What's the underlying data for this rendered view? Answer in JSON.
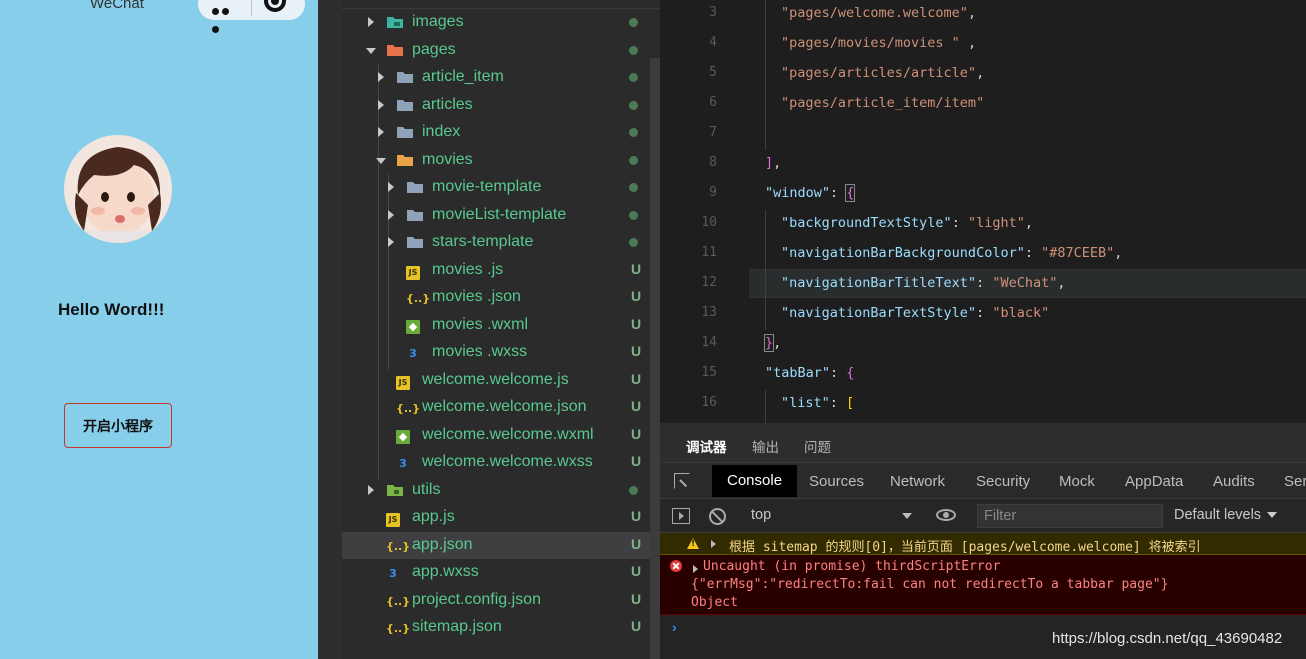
{
  "simulator": {
    "nav_title": "WeChat",
    "hello_text": "Hello Word!!!",
    "open_button": "开启小程序",
    "background_color": "#87CEEB"
  },
  "file_tree": [
    {
      "label": "images",
      "type": "folder-image",
      "status": "dot",
      "expanded": false
    },
    {
      "label": "pages",
      "type": "folder-pages",
      "status": "dot",
      "expanded": true
    },
    {
      "label": "article_item",
      "type": "folder",
      "status": "dot",
      "expanded": false
    },
    {
      "label": "articles",
      "type": "folder",
      "status": "dot",
      "expanded": false
    },
    {
      "label": "index",
      "type": "folder",
      "status": "dot",
      "expanded": false
    },
    {
      "label": "movies",
      "type": "folder-open",
      "status": "dot",
      "expanded": true
    },
    {
      "label": "movie-template",
      "type": "folder",
      "status": "dot",
      "expanded": false
    },
    {
      "label": "movieList-template",
      "type": "folder",
      "status": "dot",
      "expanded": false
    },
    {
      "label": "stars-template",
      "type": "folder",
      "status": "dot",
      "expanded": false
    },
    {
      "label": "movies .js",
      "type": "js",
      "status": "U"
    },
    {
      "label": "movies .json",
      "type": "json",
      "status": "U"
    },
    {
      "label": "movies .wxml",
      "type": "wxml",
      "status": "U"
    },
    {
      "label": "movies .wxss",
      "type": "wxss",
      "status": "U"
    },
    {
      "label": "welcome.welcome.js",
      "type": "js",
      "status": "U"
    },
    {
      "label": "welcome.welcome.json",
      "type": "json",
      "status": "U"
    },
    {
      "label": "welcome.welcome.wxml",
      "type": "wxml",
      "status": "U"
    },
    {
      "label": "welcome.welcome.wxss",
      "type": "wxss",
      "status": "U"
    },
    {
      "label": "utils",
      "type": "folder-utils",
      "status": "dot",
      "expanded": false
    },
    {
      "label": "app.js",
      "type": "js",
      "status": "U"
    },
    {
      "label": "app.json",
      "type": "json",
      "status": "U",
      "selected": true
    },
    {
      "label": "app.wxss",
      "type": "wxss",
      "status": "U"
    },
    {
      "label": "project.config.json",
      "type": "json",
      "status": "U"
    },
    {
      "label": "sitemap.json",
      "type": "json",
      "status": "U"
    }
  ],
  "editor": {
    "line_numbers": [
      "3",
      "4",
      "5",
      "6",
      "7",
      "8",
      "9",
      "10",
      "11",
      "12",
      "13",
      "14",
      "15",
      "16"
    ],
    "lines": {
      "l3": "\"pages/welcome.welcome\"",
      "l4": "\"pages/movies/movies \"",
      "l5": "\"pages/articles/article\"",
      "l6": "\"pages/article_item/item\"",
      "l9k": "\"window\"",
      "l10k": "\"backgroundTextStyle\"",
      "l10v": "\"light\"",
      "l11k": "\"navigationBarBackgroundColor\"",
      "l11v": "\"#87CEEB\"",
      "l12k": "\"navigationBarTitleText\"",
      "l12v": "\"WeChat\"",
      "l13k": "\"navigationBarTextStyle\"",
      "l13v": "\"black\"",
      "l15k": "\"tabBar\"",
      "l16k": "\"list\""
    }
  },
  "devtools": {
    "tabs": [
      "调试器",
      "输出",
      "问题"
    ],
    "panel_tabs": [
      "Console",
      "Sources",
      "Network",
      "Security",
      "Mock",
      "AppData",
      "Audits",
      "Ser"
    ],
    "context": "top",
    "filter_placeholder": "Filter",
    "levels": "Default levels",
    "warning": "根据 sitemap 的规则[0]，当前页面 [pages/welcome.welcome] 将被索引",
    "error_line1": "Uncaught (in promise) thirdScriptError",
    "error_line2": "{\"errMsg\":\"redirectTo:fail can not redirectTo a tabbar page\"}",
    "error_line3": "Object",
    "prompt": "›",
    "watermark": "https://blog.csdn.net/qq_43690482"
  }
}
